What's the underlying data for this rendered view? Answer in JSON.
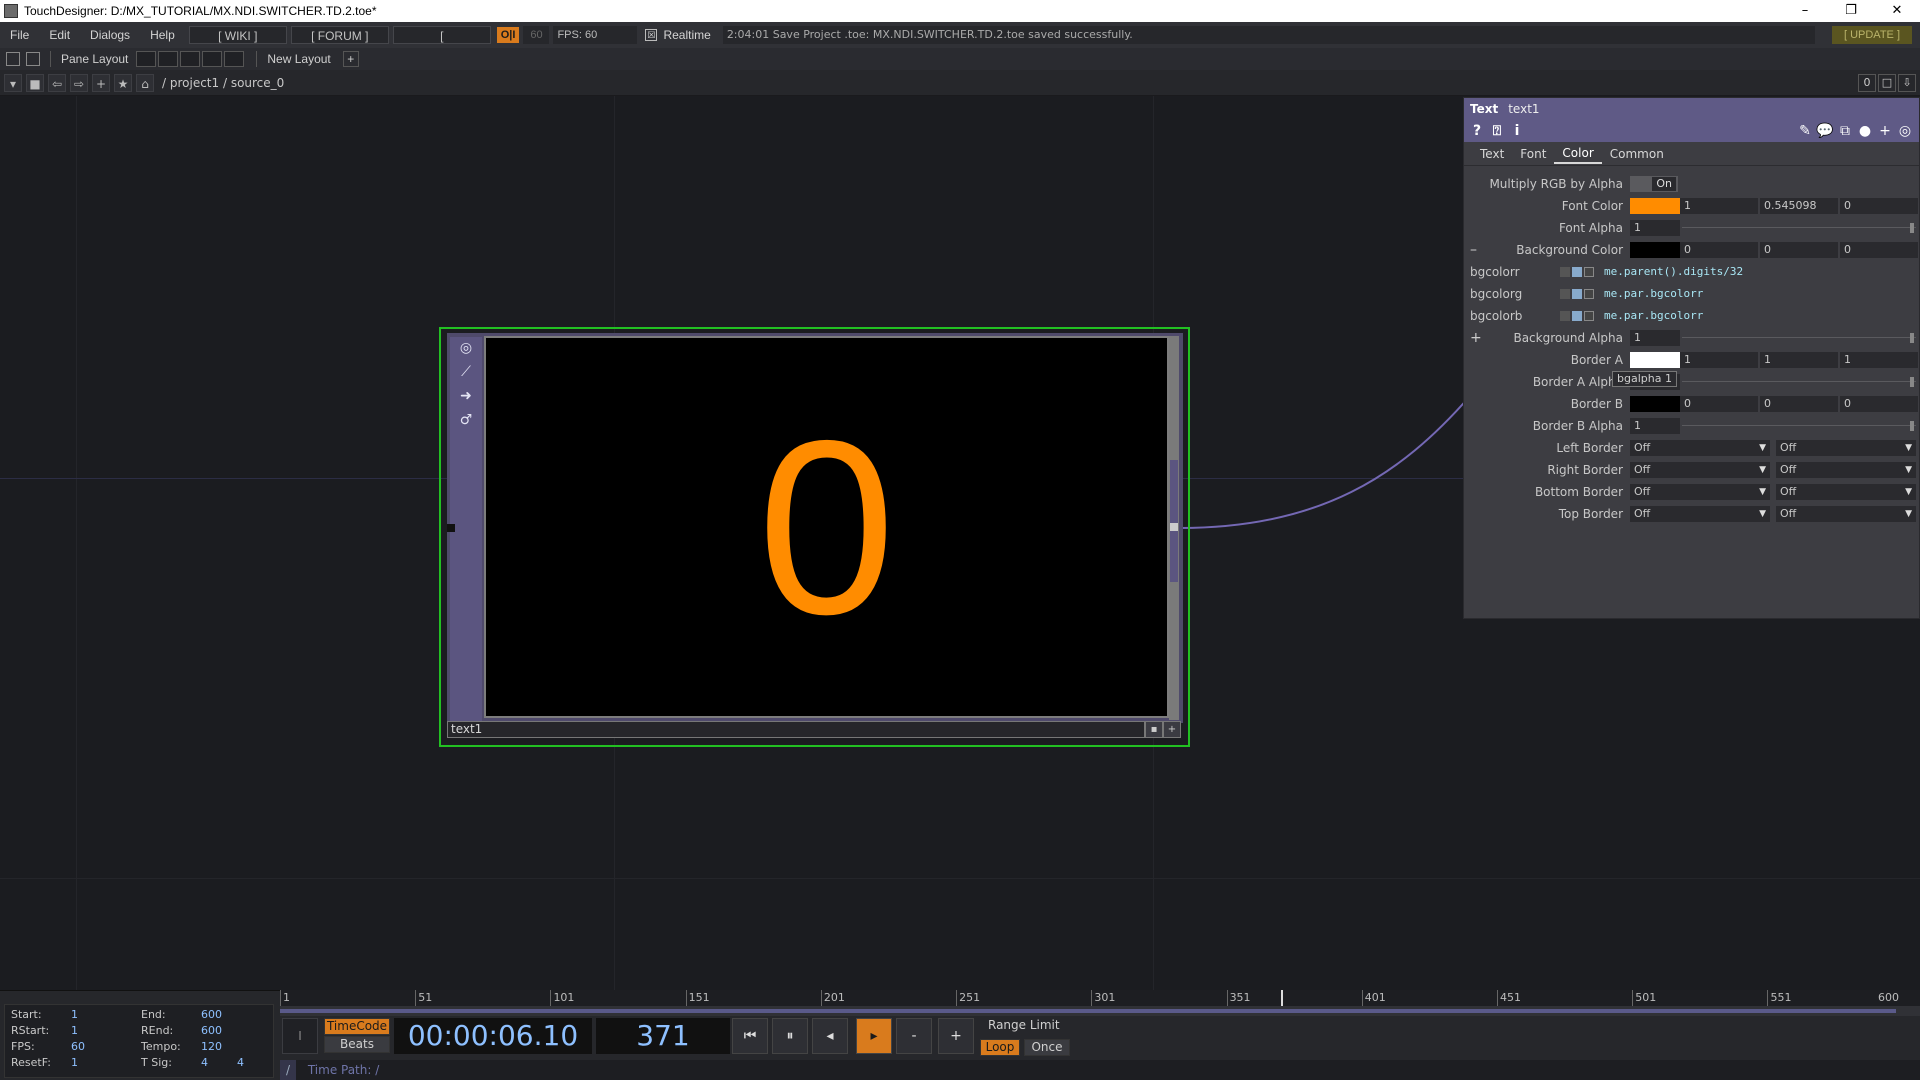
{
  "window": {
    "title": "TouchDesigner: D:/MX_TUTORIAL/MX.NDI.SWITCHER.TD.2.toe*",
    "minimize": "–",
    "restore": "❐",
    "close": "✕"
  },
  "menubar": {
    "menus": [
      "File",
      "Edit",
      "Dialogs",
      "Help"
    ],
    "wiki": "[ WIKI ]",
    "forum": "[ FORUM ]",
    "tutorials": "[ TUTORIALS ]",
    "oi": "O|I",
    "fps_setting": "60",
    "fps": "FPS: 60",
    "realtime_check": "☒",
    "realtime": "Realtime",
    "status": "2:04:01 Save Project .toe: MX.NDI.SWITCHER.TD.2.toe saved successfully.",
    "update": "[ UPDATE ]"
  },
  "panebar": {
    "pane_layout": "Pane Layout",
    "new_layout": "New Layout",
    "plus": "+"
  },
  "pathbar": {
    "path": "/ project1 / source_0",
    "zero": "0"
  },
  "node": {
    "name": "text1",
    "display_value": "0"
  },
  "params": {
    "op_type": "Text",
    "op_name": "text1",
    "tabs": [
      "Text",
      "Font",
      "Color",
      "Common"
    ],
    "active_tab": "Color",
    "rows": {
      "multiply_rgb": {
        "label": "Multiply RGB by Alpha",
        "value": "On"
      },
      "font_color": {
        "label": "Font Color",
        "color": "#ff8c00",
        "v1": "1",
        "v2": "0.545098",
        "v3": "0"
      },
      "font_alpha": {
        "label": "Font Alpha",
        "value": "1"
      },
      "bg_color": {
        "label": "Background Color",
        "toggle": "–",
        "color": "#000000",
        "v1": "0",
        "v2": "0",
        "v3": "0"
      },
      "bgcolorr": {
        "label": "bgcolorr",
        "expr": "me.parent().digits/32"
      },
      "bgcolorg": {
        "label": "bgcolorg",
        "expr": "me.par.bgcolorr"
      },
      "bgcolorb": {
        "label": "bgcolorb",
        "expr": "me.par.bgcolorr"
      },
      "bg_alpha": {
        "label": "Background Alpha",
        "toggle": "+",
        "value": "1"
      },
      "border_a": {
        "label": "Border A",
        "color": "#ffffff",
        "v1": "1",
        "v2": "1",
        "v3": "1"
      },
      "border_a_alpha": {
        "label": "Border A Alpha",
        "value": ""
      },
      "border_b": {
        "label": "Border B",
        "color": "#000000",
        "v1": "0",
        "v2": "0",
        "v3": "0"
      },
      "border_b_alpha": {
        "label": "Border B Alpha",
        "value": "1"
      },
      "left_border": {
        "label": "Left Border",
        "v1": "Off",
        "v2": "Off"
      },
      "right_border": {
        "label": "Right Border",
        "v1": "Off",
        "v2": "Off"
      },
      "bottom_border": {
        "label": "Bottom Border",
        "v1": "Off",
        "v2": "Off"
      },
      "top_border": {
        "label": "Top Border",
        "v1": "Off",
        "v2": "Off"
      }
    },
    "tooltip": "bgalpha   1"
  },
  "timeline": {
    "stats": {
      "start_k": "Start:",
      "start_v": "1",
      "end_k": "End:",
      "end_v": "600",
      "rstart_k": "RStart:",
      "rstart_v": "1",
      "rend_k": "REnd:",
      "rend_v": "600",
      "fps_k": "FPS:",
      "fps_v": "60",
      "tempo_k": "Tempo:",
      "tempo_v": "120",
      "resetf_k": "ResetF:",
      "resetf_v": "1",
      "tsig_k": "T Sig:",
      "tsig_v1": "4",
      "tsig_v2": "4"
    },
    "ruler_ticks": [
      "1",
      "51",
      "101",
      "151",
      "201",
      "251",
      "301",
      "351",
      "401",
      "451",
      "501",
      "551",
      "600"
    ],
    "io": "I",
    "timecode_toggle": "TimeCode",
    "beats_toggle": "Beats",
    "timecode": "00:00:06.10",
    "frame": "371",
    "btn_rewind": "⏮",
    "btn_pause": "⏸",
    "btn_back": "◂",
    "btn_play": "▸",
    "btn_minus": "-",
    "btn_plus": "+",
    "range_limit": "Range Limit",
    "loop": "Loop",
    "once": "Once",
    "timepath_slash": "/",
    "timepath": "Time Path: /"
  }
}
